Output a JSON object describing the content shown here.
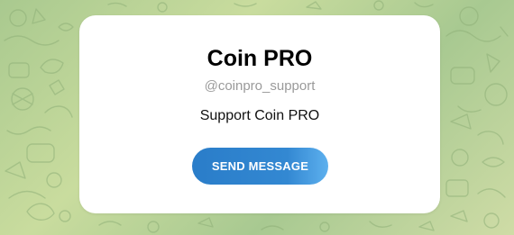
{
  "card": {
    "title": "Coin PRO",
    "username": "@coinpro_support",
    "description": "Support Coin PRO",
    "button_label": "SEND MESSAGE"
  },
  "colors": {
    "button_accent": "#2a7dc9",
    "username_gray": "#9a9a9a",
    "background_green": "#a9c98f"
  }
}
